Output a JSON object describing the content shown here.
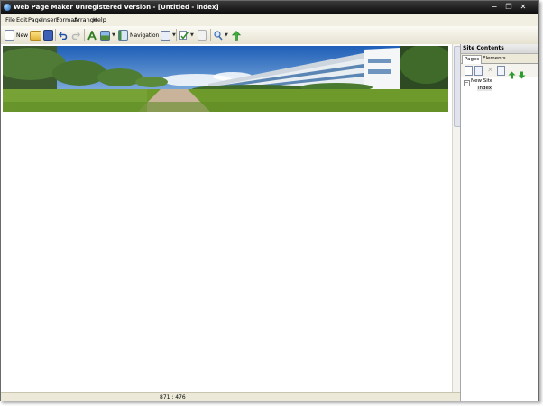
{
  "window": {
    "title": "Web Page Maker Unregistered Version - [Untitled - index]",
    "controls": [
      "−",
      "❐",
      "✕"
    ]
  },
  "menu": [
    "File",
    "Edit",
    "Page",
    "Insert",
    "Format",
    "Arrange",
    "Help"
  ],
  "toolbar": {
    "new_label": "New",
    "navigation_bar_label": "Navigation Bar"
  },
  "status": {
    "coordinates": "871 : 476"
  },
  "panel": {
    "header": "Site Contents",
    "tabs": [
      "Pages",
      "Elements"
    ],
    "tree": {
      "root": "New Site",
      "children": [
        "index"
      ]
    }
  },
  "colors": {
    "titlebar": "#1a1a1a",
    "chrome": "#ece9d8",
    "sky": "#6f9fd6",
    "grass": "#6e9a2c"
  }
}
